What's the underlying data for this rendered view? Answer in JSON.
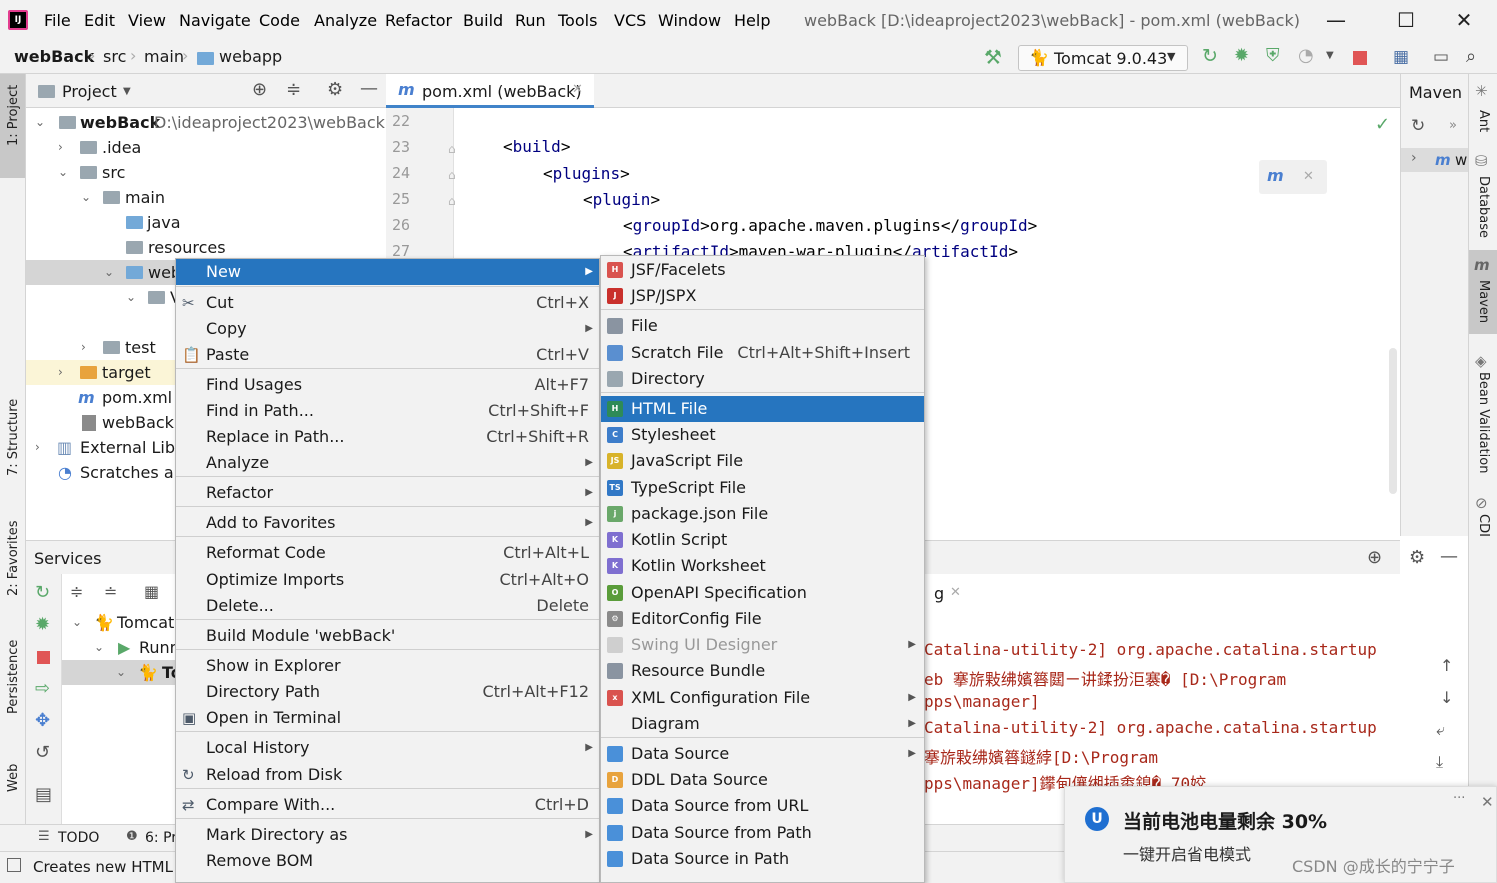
{
  "menubar": {
    "items": [
      "File",
      "Edit",
      "View",
      "Navigate",
      "Code",
      "Analyze",
      "Refactor",
      "Build",
      "Run",
      "Tools",
      "VCS",
      "Window",
      "Help"
    ],
    "window_title": "webBack [D:\\ideaproject2023\\webBack] - pom.xml (webBack)"
  },
  "navbar": {
    "crumbs": [
      "webBack",
      "src",
      "main",
      "webapp"
    ],
    "run_config": "Tomcat 9.0.43"
  },
  "left_stripe": [
    "1: Project",
    "7: Structure",
    "2: Favorites",
    "Persistence",
    "Web"
  ],
  "project": {
    "title": "Project",
    "rows": [
      {
        "name": "webBack",
        "extra": "D:\\ideaproject2023\\webBack"
      },
      {
        "name": ".idea"
      },
      {
        "name": "src"
      },
      {
        "name": "main"
      },
      {
        "name": "java"
      },
      {
        "name": "resources"
      },
      {
        "name": "web"
      },
      {
        "name": "V"
      },
      {
        "name": "test"
      },
      {
        "name": "target"
      },
      {
        "name": "pom.xml"
      },
      {
        "name": "webBack.i"
      },
      {
        "name": "External Libra"
      },
      {
        "name": "Scratches and"
      }
    ]
  },
  "editor": {
    "tab": "pom.xml (webBack)",
    "lines": [
      {
        "n": "22",
        "text": ""
      },
      {
        "n": "23",
        "open": "<",
        "tag": "build",
        "close": ">"
      },
      {
        "n": "24",
        "open": "<",
        "tag": "plugins",
        "close": ">"
      },
      {
        "n": "25",
        "open": "<",
        "tag": "plugin",
        "close": ">"
      },
      {
        "n": "26",
        "open": "<",
        "tag": "groupId",
        "mid": ">org.apache.maven.plugins</",
        "tag2": "groupId",
        "close": ">"
      },
      {
        "n": "27",
        "open": "<",
        "tag": "artifactId",
        "mid": ">maven-war-plugin</",
        "tag2": "artifactId",
        "close": ">"
      }
    ]
  },
  "maven": {
    "title": "Maven",
    "item": "w"
  },
  "right_stripe": [
    "Ant",
    "Database",
    "Maven",
    "Bean Validation",
    "CDI"
  ],
  "services": {
    "title": "Services",
    "tree": [
      "Tomcat",
      "Runn",
      "To"
    ],
    "tab_suffix": "g",
    "console": [
      "Catalina-utility-2] org.apache.catalina.startup",
      "eb 搴旂敤绋嬪簭閮ㄧ讲鍒扮洰褰� [D:\\Program",
      "pps\\manager]",
      "Catalina-utility-2] org.apache.catalina.startup",
      "搴旂敤绋嬪簭鐩綍[D:\\Program",
      "pps\\manager]鑻甸儴缃插畬鎴�,70姣"
    ]
  },
  "bottom_tabs": [
    "TODO",
    "6: Pr"
  ],
  "status": "Creates new HTML f",
  "context_menu": {
    "items": [
      {
        "label": "New",
        "shortcut": "",
        "sub": true,
        "sel": true
      },
      {
        "label": "Cut",
        "shortcut": "Ctrl+X"
      },
      {
        "label": "Copy",
        "shortcut": "",
        "sub": true
      },
      {
        "label": "Paste",
        "shortcut": "Ctrl+V"
      },
      {
        "label": "Find Usages",
        "shortcut": "Alt+F7"
      },
      {
        "label": "Find in Path...",
        "shortcut": "Ctrl+Shift+F"
      },
      {
        "label": "Replace in Path...",
        "shortcut": "Ctrl+Shift+R"
      },
      {
        "label": "Analyze",
        "shortcut": "",
        "sub": true
      },
      {
        "label": "Refactor",
        "shortcut": "",
        "sub": true
      },
      {
        "label": "Add to Favorites",
        "shortcut": "",
        "sub": true
      },
      {
        "label": "Reformat Code",
        "shortcut": "Ctrl+Alt+L"
      },
      {
        "label": "Optimize Imports",
        "shortcut": "Ctrl+Alt+O"
      },
      {
        "label": "Delete...",
        "shortcut": "Delete"
      },
      {
        "label": "Build Module 'webBack'",
        "shortcut": ""
      },
      {
        "label": "Show in Explorer",
        "shortcut": ""
      },
      {
        "label": "Directory Path",
        "shortcut": "Ctrl+Alt+F12"
      },
      {
        "label": "Open in Terminal",
        "shortcut": ""
      },
      {
        "label": "Local History",
        "shortcut": "",
        "sub": true
      },
      {
        "label": "Reload from Disk",
        "shortcut": ""
      },
      {
        "label": "Compare With...",
        "shortcut": "Ctrl+D"
      },
      {
        "label": "Mark Directory as",
        "shortcut": "",
        "sub": true
      },
      {
        "label": "Remove BOM",
        "shortcut": ""
      }
    ]
  },
  "new_submenu": {
    "items": [
      {
        "label": "JSF/Facelets",
        "shortcut": ""
      },
      {
        "label": "JSP/JSPX",
        "shortcut": ""
      },
      {
        "label": "File",
        "shortcut": ""
      },
      {
        "label": "Scratch File",
        "shortcut": "Ctrl+Alt+Shift+Insert"
      },
      {
        "label": "Directory",
        "shortcut": ""
      },
      {
        "label": "HTML File",
        "shortcut": "",
        "sel": true
      },
      {
        "label": "Stylesheet",
        "shortcut": ""
      },
      {
        "label": "JavaScript File",
        "shortcut": ""
      },
      {
        "label": "TypeScript File",
        "shortcut": ""
      },
      {
        "label": "package.json File",
        "shortcut": ""
      },
      {
        "label": "Kotlin Script",
        "shortcut": ""
      },
      {
        "label": "Kotlin Worksheet",
        "shortcut": ""
      },
      {
        "label": "OpenAPI Specification",
        "shortcut": ""
      },
      {
        "label": "EditorConfig File",
        "shortcut": ""
      },
      {
        "label": "Swing UI Designer",
        "shortcut": "",
        "sub": true,
        "dis": true
      },
      {
        "label": "Resource Bundle",
        "shortcut": ""
      },
      {
        "label": "XML Configuration File",
        "shortcut": "",
        "sub": true
      },
      {
        "label": "Diagram",
        "shortcut": "",
        "sub": true
      },
      {
        "label": "Data Source",
        "shortcut": "",
        "sub": true
      },
      {
        "label": "DDL Data Source",
        "shortcut": ""
      },
      {
        "label": "Data Source from URL",
        "shortcut": ""
      },
      {
        "label": "Data Source from Path",
        "shortcut": ""
      },
      {
        "label": "Data Source in Path",
        "shortcut": ""
      }
    ]
  },
  "notification": {
    "title": "当前电池电量剩余 30%",
    "body": "一键开启省电模式",
    "watermark": "CSDN @成长的宁宁子"
  },
  "colors": {
    "selection": "#2675bf",
    "tag": "#000080",
    "console": "#a8281a",
    "accent_green": "#59a869",
    "stop_red": "#e05555"
  }
}
